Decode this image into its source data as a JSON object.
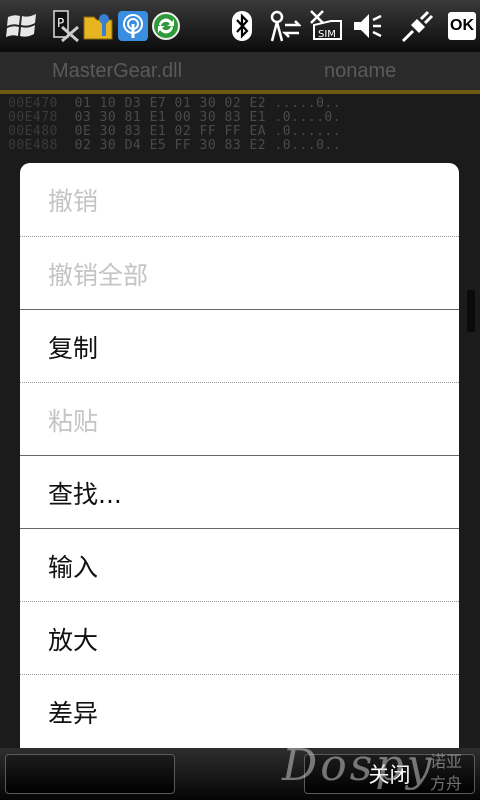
{
  "status_bar": {
    "windows_icon": "windows-flag-icon",
    "ok_label": "OK",
    "sim_label": "SIM"
  },
  "editor": {
    "tabs": [
      "MasterGear.dll",
      "noname"
    ],
    "hex_rows": [
      {
        "addr": "00E470",
        "bytes": "01 10 D3 E7 01 30 02 E2",
        "ascii": ".....0.."
      },
      {
        "addr": "00E478",
        "bytes": "03 30 81 E1 00 30 83 E1",
        "ascii": ".0....0."
      },
      {
        "addr": "00E480",
        "bytes": "0E 30 83 E1 02 FF FF EA",
        "ascii": ".0......"
      },
      {
        "addr": "00E488",
        "bytes": "02 30 D4 E5 FF 30 83 E2",
        "ascii": ".0...0.."
      }
    ]
  },
  "menu": {
    "items": [
      {
        "label": "撤销",
        "enabled": false
      },
      {
        "label": "撤销全部",
        "enabled": false
      },
      {
        "label": "复制",
        "enabled": true
      },
      {
        "label": "粘贴",
        "enabled": false
      },
      {
        "label": "查找...",
        "enabled": true
      },
      {
        "label": "输入",
        "enabled": true
      },
      {
        "label": "放大",
        "enabled": true
      },
      {
        "label": "差异",
        "enabled": true
      }
    ]
  },
  "softkeys": {
    "left": "",
    "right": "关闭"
  },
  "watermark": {
    "brand": "Dospy",
    "line1": "诺亚",
    "line2": "方舟"
  }
}
